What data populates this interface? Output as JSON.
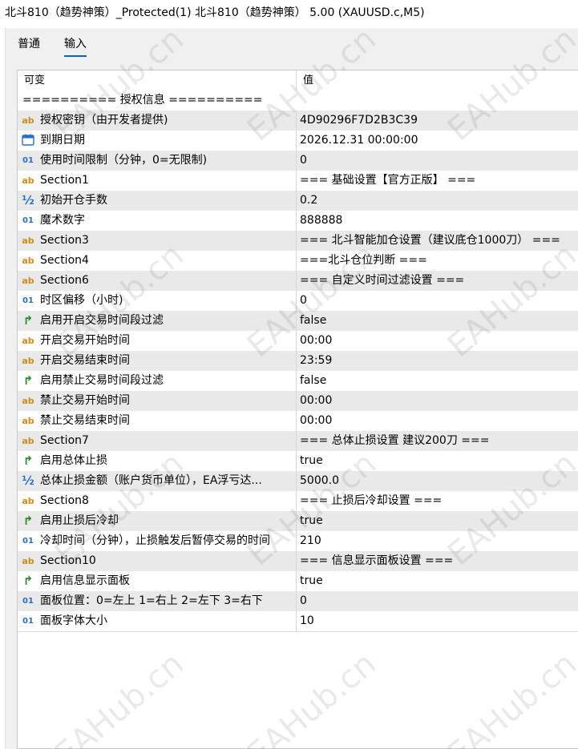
{
  "window": {
    "title": "北斗810（趋势神策）_Protected(1) 北斗810（趋势神策） 5.00 (XAUUSD.c,M5)"
  },
  "tabs": [
    {
      "label": "普通",
      "active": false
    },
    {
      "label": "输入",
      "active": true
    }
  ],
  "table": {
    "col_variable": "可变",
    "col_value": "值",
    "rows": [
      {
        "icon": "none",
        "name": "========== 授权信息 ==========",
        "value": ""
      },
      {
        "icon": "string-icon",
        "name": "授权密钥（由开发者提供)",
        "value": "4D90296F7D2B3C39"
      },
      {
        "icon": "calendar-icon",
        "name": "到期日期",
        "value": "2026.12.31 00:00:00"
      },
      {
        "icon": "integer-icon",
        "name": "使用时间限制（分钟，0=无限制)",
        "value": "0"
      },
      {
        "icon": "string-icon",
        "name": "Section1",
        "value": "=== 基础设置【官方正版】 ==="
      },
      {
        "icon": "double-icon",
        "name": "初始开仓手数",
        "value": "0.2"
      },
      {
        "icon": "integer-icon",
        "name": "魔术数字",
        "value": "888888"
      },
      {
        "icon": "string-icon",
        "name": "Section3",
        "value": "=== 北斗智能加仓设置（建议底仓1000刀） ==="
      },
      {
        "icon": "string-icon",
        "name": "Section4",
        "value": "===北斗仓位判断 ==="
      },
      {
        "icon": "string-icon",
        "name": "Section6",
        "value": "=== 自定义时间过滤设置 ==="
      },
      {
        "icon": "integer-icon",
        "name": "时区偏移（小时)",
        "value": "0"
      },
      {
        "icon": "bool-icon",
        "name": "启用开启交易时间段过滤",
        "value": "false"
      },
      {
        "icon": "string-icon",
        "name": "开启交易开始时间",
        "value": "00:00"
      },
      {
        "icon": "string-icon",
        "name": "开启交易结束时间",
        "value": "23:59"
      },
      {
        "icon": "bool-icon",
        "name": "启用禁止交易时间段过滤",
        "value": "false"
      },
      {
        "icon": "string-icon",
        "name": "禁止交易开始时间",
        "value": "00:00"
      },
      {
        "icon": "string-icon",
        "name": "禁止交易结束时间",
        "value": "00:00"
      },
      {
        "icon": "string-icon",
        "name": "Section7",
        "value": "=== 总体止损设置 建议200刀 ==="
      },
      {
        "icon": "bool-icon",
        "name": "启用总体止损",
        "value": "true"
      },
      {
        "icon": "double-icon",
        "name": "总体止损金额（账户货币单位），EA浮亏达...",
        "value": "5000.0"
      },
      {
        "icon": "string-icon",
        "name": "Section8",
        "value": "=== 止损后冷却设置 ==="
      },
      {
        "icon": "bool-icon",
        "name": "启用止损后冷却",
        "value": "true"
      },
      {
        "icon": "integer-icon",
        "name": "冷却时间（分钟），止损触发后暂停交易的时间",
        "value": "210"
      },
      {
        "icon": "string-icon",
        "name": "Section10",
        "value": "=== 信息显示面板设置 ==="
      },
      {
        "icon": "bool-icon",
        "name": "启用信息显示面板",
        "value": "true"
      },
      {
        "icon": "integer-icon",
        "name": "面板位置：0=左上 1=右上 2=左下 3=右下",
        "value": "0"
      },
      {
        "icon": "integer-icon",
        "name": "面板字体大小",
        "value": "10"
      }
    ]
  },
  "watermark": "EAHub.cn"
}
